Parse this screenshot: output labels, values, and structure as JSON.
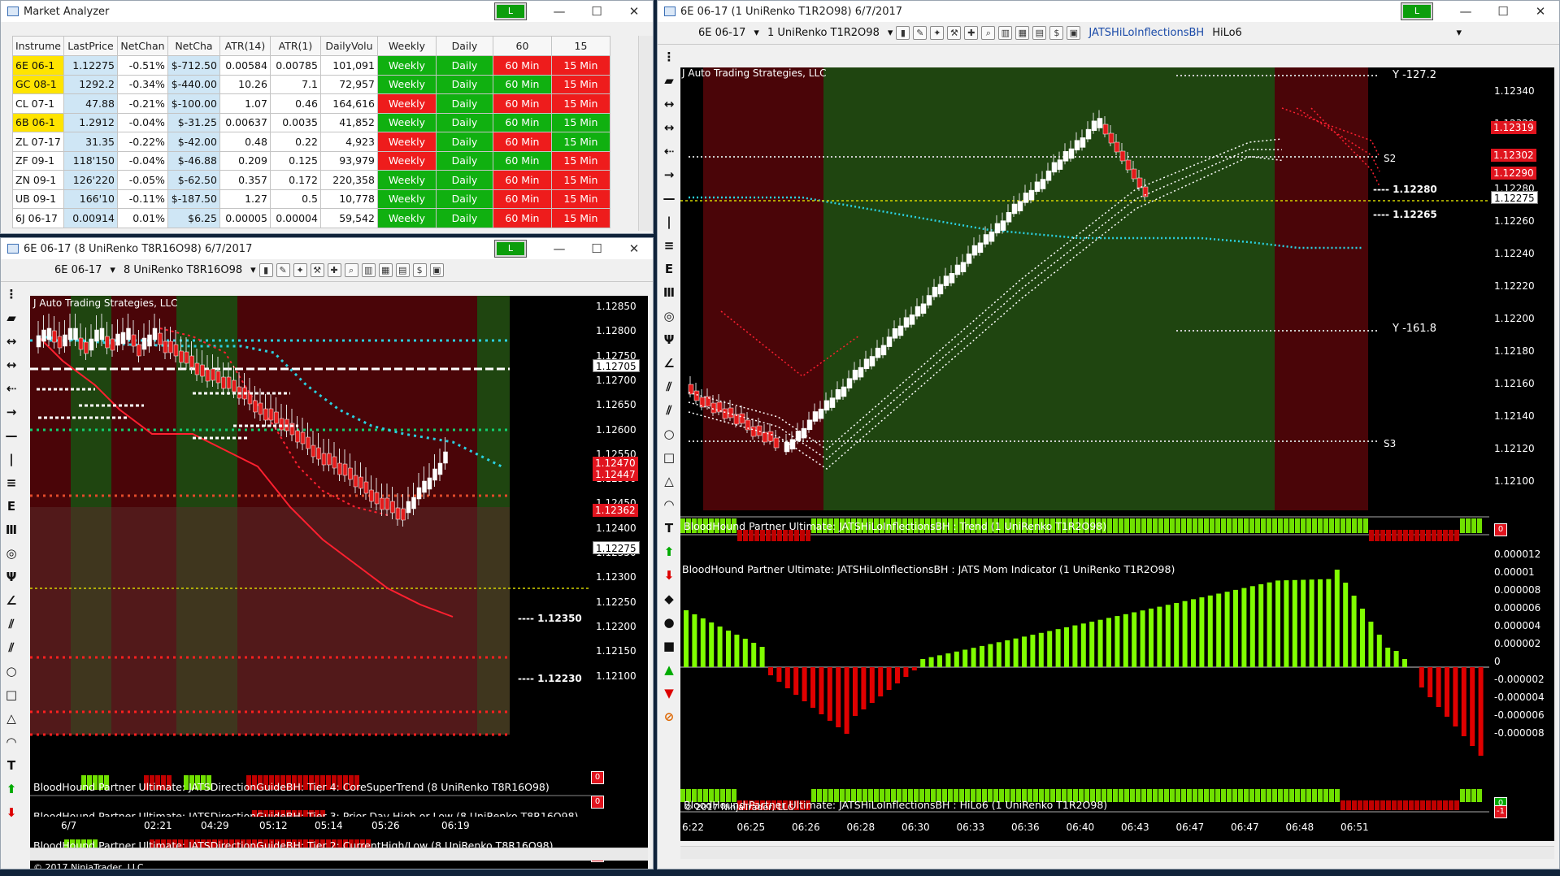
{
  "market_analyzer": {
    "title": "Market Analyzer",
    "lock": "L",
    "columns": [
      "Instrume",
      "LastPrice",
      "NetChan",
      "NetCha",
      "ATR(14)",
      "ATR(1)",
      "DailyVolu",
      "Weekly",
      "Daily",
      "60",
      "15"
    ],
    "rows": [
      {
        "sym": "6E 06-1",
        "last": "1.12275",
        "netpct": "-0.51%",
        "netcash": "$-712.50",
        "atr14": "0.00584",
        "atr1": "0.00785",
        "vol": "101,091",
        "w": "Weekly",
        "d": "Daily",
        "h": "60 Min",
        "m": "15 Min"
      },
      {
        "sym": "GC 08-1",
        "last": "1292.2",
        "netpct": "-0.34%",
        "netcash": "$-440.00",
        "atr14": "10.26",
        "atr1": "7.1",
        "vol": "72,957",
        "w": "Weekly",
        "d": "Daily",
        "h": "60 Min",
        "m": "15 Min"
      },
      {
        "sym": "CL 07-1",
        "last": "47.88",
        "netpct": "-0.21%",
        "netcash": "$-100.00",
        "atr14": "1.07",
        "atr1": "0.46",
        "vol": "164,616",
        "w": "Weekly",
        "d": "Daily",
        "h": "60 Min",
        "m": "15 Min"
      },
      {
        "sym": "6B 06-1",
        "last": "1.2912",
        "netpct": "-0.04%",
        "netcash": "$-31.25",
        "atr14": "0.00637",
        "atr1": "0.0035",
        "vol": "41,852",
        "w": "Weekly",
        "d": "Daily",
        "h": "60 Min",
        "m": "15 Min"
      },
      {
        "sym": "ZL 07-17",
        "last": "31.35",
        "netpct": "-0.22%",
        "netcash": "$-42.00",
        "atr14": "0.48",
        "atr1": "0.22",
        "vol": "4,923",
        "w": "Weekly",
        "d": "Daily",
        "h": "60 Min",
        "m": "15 Min"
      },
      {
        "sym": "ZF 09-1",
        "last": "118'150",
        "netpct": "-0.04%",
        "netcash": "$-46.88",
        "atr14": "0.209",
        "atr1": "0.125",
        "vol": "93,979",
        "w": "Weekly",
        "d": "Daily",
        "h": "60 Min",
        "m": "15 Min"
      },
      {
        "sym": "ZN 09-1",
        "last": "126'220",
        "netpct": "-0.05%",
        "netcash": "$-62.50",
        "atr14": "0.357",
        "atr1": "0.172",
        "vol": "220,358",
        "w": "Weekly",
        "d": "Daily",
        "h": "60 Min",
        "m": "15 Min"
      },
      {
        "sym": "UB 09-1",
        "last": "166'10",
        "netpct": "-0.11%",
        "netcash": "$-187.50",
        "atr14": "1.27",
        "atr1": "0.5",
        "vol": "10,778",
        "w": "Weekly",
        "d": "Daily",
        "h": "60 Min",
        "m": "15 Min"
      },
      {
        "sym": "6J 06-17",
        "last": "0.00914",
        "netpct": "0.01%",
        "netcash": "$6.25",
        "atr14": "0.00005",
        "atr1": "0.00004",
        "vol": "59,542",
        "w": "Weekly",
        "d": "Daily",
        "h": "60 Min",
        "m": "15 Min"
      }
    ],
    "cell_colors": {
      "w": [
        "g",
        "g",
        "r",
        "g",
        "r",
        "r",
        "g",
        "g",
        "g"
      ],
      "d": [
        "g",
        "g",
        "g",
        "g",
        "g",
        "g",
        "g",
        "g",
        "g"
      ],
      "h": [
        "r",
        "g",
        "r",
        "g",
        "r",
        "g",
        "r",
        "r",
        "r"
      ],
      "m": [
        "r",
        "r",
        "r",
        "g",
        "g",
        "r",
        "r",
        "r",
        "r"
      ]
    }
  },
  "chart_left": {
    "title": "6E 06-17 (8 UniRenko T8R16O98)  6/7/2017",
    "lock": "L",
    "instrument": "6E 06-17",
    "bartype": "8 UniRenko T8R16O98",
    "watermark": "J Auto Trading Strategies, LLC",
    "price_axis": [
      "1.12850",
      "1.12800",
      "1.12750",
      "1.12700",
      "1.12650",
      "1.12600",
      "1.12550",
      "1.12500",
      "1.12450",
      "1.12400",
      "1.12350",
      "1.12300",
      "1.12250",
      "1.12200",
      "1.12150",
      "1.12100"
    ],
    "tags": {
      "a": "1.12705",
      "b": "1.12470",
      "c": "1.12447",
      "d": "1.12362",
      "e": "1.12275"
    },
    "levels": {
      "hi": "1.12350",
      "lo": "1.12230"
    },
    "indicators": [
      "BloodHound Partner Ultimate: JATSDirectionGuideBH: Tier 4: CoreSuperTrend (8 UniRenko T8R16O98)",
      "BloodHound Partner Ultimate: JATSDirectionGuideBH: Tier 3: Prior Day High or Low (8 UniRenko T8R16O98)",
      "BloodHound Partner Ultimate: JATSDirectionGuideBH: Tier 2: CurrentHigh/Low (8 UniRenko T8R16O98)",
      "© 2017 NinjaTrader, LLC"
    ],
    "zero": "0",
    "time_axis": [
      "6/7",
      "02:21",
      "04:29",
      "05:12",
      "05:14",
      "05:26",
      "06:19"
    ]
  },
  "chart_right": {
    "title": "6E 06-17 (1 UniRenko T1R2O98)  6/7/2017",
    "lock": "L",
    "instrument": "6E 06-17",
    "bartype": "1 UniRenko T1R2O98",
    "indicator_sel": "JATSHiLoInflectionsBH",
    "hilo": "HiLo6",
    "watermark": "J Auto Trading Strategies, LLC",
    "price_axis": [
      "1.12340",
      "1.12320",
      "1.12300",
      "1.12280",
      "1.12260",
      "1.12240",
      "1.12220",
      "1.12200",
      "1.12180",
      "1.12160",
      "1.12140",
      "1.12120",
      "1.12100"
    ],
    "tags": {
      "a": "1.12319",
      "b": "1.12302",
      "c": "1.12290",
      "d": "1.12275"
    },
    "labels": {
      "y1": "Y -127.2",
      "s2": "S2",
      "y2": "Y -161.8",
      "s3": "S3",
      "p1": "1.12280",
      "p2": "1.12265"
    },
    "strip_title": "BloodHound Partner Ultimate: JATSHiLoInflectionsBH : Trend (1 UniRenko T1R2O98)",
    "mom_title": "BloodHound Partner Ultimate: JATSHiLoInflectionsBH : JATS Mom Indicator (1 UniRenko T1R2O98)",
    "mom_axis": [
      "0.000012",
      "0.00001",
      "0.000008",
      "0.000006",
      "0.000004",
      "0.000002",
      "0",
      "-0.000002",
      "-0.000004",
      "-0.000006",
      "-0.000008"
    ],
    "bottom_title": "© 2017 NinjaTrader, LLC",
    "bottom_title2": "BloodHound Partner Ultimate: JATSHiLoInflectionsBH : HiLo6 (1 UniRenko T1R2O98)",
    "zero": "0",
    "neg": "-1",
    "time_axis": [
      "6:22",
      "06:25",
      "06:26",
      "06:28",
      "06:30",
      "06:33",
      "06:36",
      "06:40",
      "06:43",
      "06:47",
      "06:47",
      "06:48",
      "06:51"
    ]
  },
  "colors": {
    "bull": "#80ff00",
    "bear": "#e00000",
    "green_zone": "#1f4510",
    "red_zone": "#4a0508",
    "accent": "#1a4aa8"
  }
}
